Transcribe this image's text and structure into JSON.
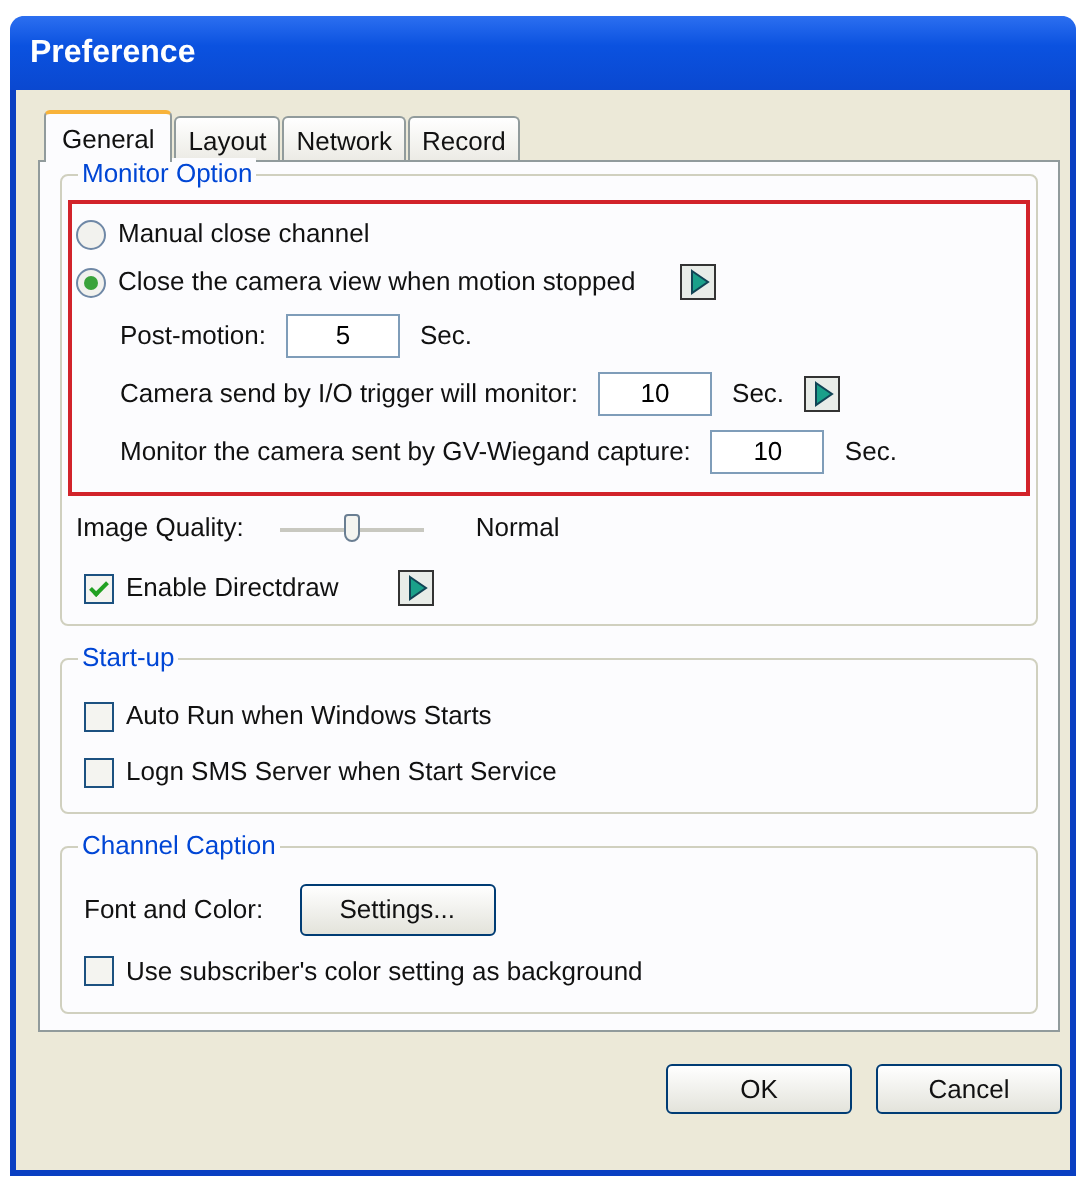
{
  "window": {
    "title": "Preference"
  },
  "tabs": [
    {
      "label": "General",
      "selected": true
    },
    {
      "label": "Layout",
      "selected": false
    },
    {
      "label": "Network",
      "selected": false
    },
    {
      "label": "Record",
      "selected": false
    }
  ],
  "monitor_option": {
    "title": "Monitor Option",
    "highlighted": true,
    "radios": [
      {
        "label": "Manual close channel",
        "selected": false,
        "info_button": false
      },
      {
        "label": "Close the camera view when motion stopped",
        "selected": true,
        "info_button": true
      }
    ],
    "fields": [
      {
        "label": "Post-motion:",
        "value": "5",
        "unit": "Sec.",
        "info_button": false
      },
      {
        "label": "Camera send by I/O trigger will monitor:",
        "value": "10",
        "unit": "Sec.",
        "info_button": true
      },
      {
        "label": "Monitor the camera sent by GV-Wiegand capture:",
        "value": "10",
        "unit": "Sec.",
        "info_button": false
      }
    ],
    "image_quality": {
      "label": "Image Quality:",
      "level": 0.5,
      "reading": "Normal"
    },
    "directdraw": {
      "label": "Enable Directdraw",
      "checked": true,
      "info_button": true
    }
  },
  "startup": {
    "title": "Start-up",
    "checkboxes": [
      {
        "label": "Auto Run when Windows Starts",
        "checked": false
      },
      {
        "label": "Logn SMS Server when Start Service",
        "checked": false
      }
    ]
  },
  "channel_caption": {
    "title": "Channel Caption",
    "font_label": "Font and Color:",
    "button": "Settings...",
    "checkbox": {
      "label": "Use subscriber's color setting as background",
      "checked": false
    }
  },
  "buttons": [
    "OK",
    "Cancel"
  ]
}
